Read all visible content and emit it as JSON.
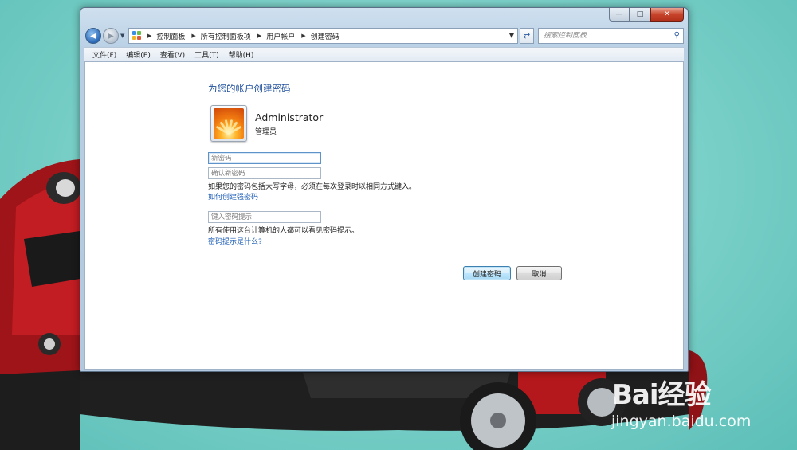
{
  "window": {
    "caption_buttons": [
      "minimize",
      "maximize",
      "close"
    ]
  },
  "address_bar": {
    "breadcrumbs": [
      "控制面板",
      "所有控制面板项",
      "用户帐户",
      "创建密码"
    ],
    "search_placeholder": "搜索控制面板"
  },
  "menu": {
    "items": [
      "文件(F)",
      "编辑(E)",
      "查看(V)",
      "工具(T)",
      "帮助(H)"
    ]
  },
  "main": {
    "heading": "为您的帐户创建密码",
    "user": {
      "name": "Administrator",
      "role": "管理员"
    },
    "new_password_placeholder": "新密码",
    "confirm_password_placeholder": "确认新密码",
    "caps_note": "如果您的密码包括大写字母，必须在每次登录时以相同方式键入。",
    "strong_password_link": "如何创建强密码",
    "hint_placeholder": "键入密码提示",
    "hint_note": "所有使用这台计算机的人都可以看见密码提示。",
    "hint_link": "密码提示是什么?"
  },
  "buttons": {
    "create": "创建密码",
    "cancel": "取消"
  },
  "watermark": {
    "logo": "Bai经验",
    "url": "jingyan.baidu.com"
  },
  "colors": {
    "accent": "#1e4e9c",
    "link": "#1f5fb8",
    "desktop": "#7fd3cb",
    "car_red": "#b5181c"
  }
}
